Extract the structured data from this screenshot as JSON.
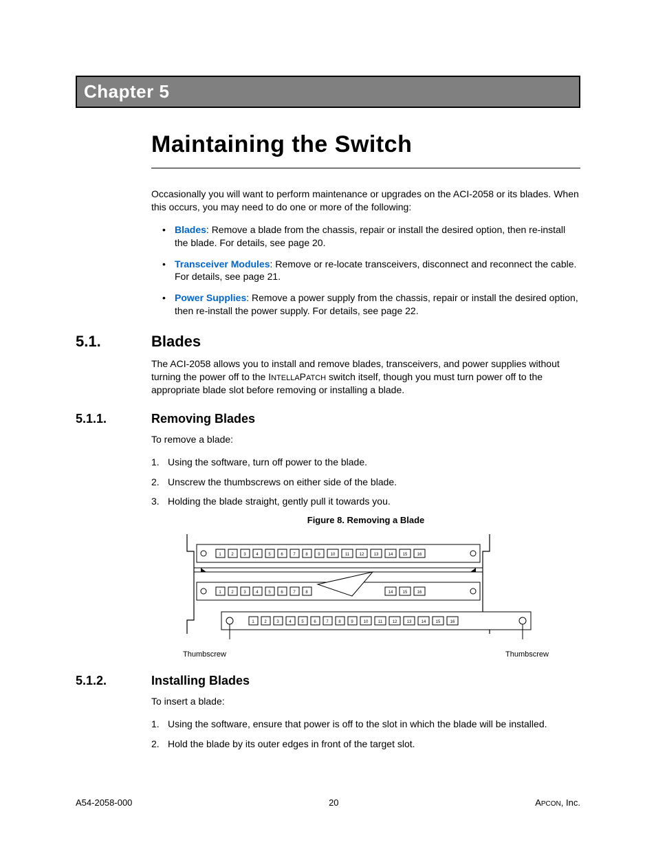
{
  "chapter_label": "Chapter 5",
  "main_title": "Maintaining the Switch",
  "intro_para": "Occasionally you will want to perform maintenance or upgrades on the ACI-2058 or its blades. When this occurs, you may need to do one or more of the following:",
  "bullets": [
    {
      "term": "Blades",
      "rest": ": Remove a blade from the chassis, repair or install the desired option, then re-install the blade. For details, see page 20."
    },
    {
      "term": "Transceiver Modules",
      "rest": ": Remove or re-locate transceivers, disconnect and reconnect the cable. For details, see page 21."
    },
    {
      "term": "Power Supplies",
      "rest": ": Remove a power supply from the chassis, repair or install the desired option, then re-install the power supply. For details, see page 22."
    }
  ],
  "sec_5_1": {
    "num": "5.1.",
    "title": "Blades"
  },
  "sec_5_1_para_a": "The ACI-2058 allows you to install and remove blades, transceivers, and power supplies without turning the power off to the I",
  "sec_5_1_para_b": "NTELLA",
  "sec_5_1_para_c": "P",
  "sec_5_1_para_d": "ATCH",
  "sec_5_1_para_e": " switch itself, though you must turn power off to the appropriate blade slot before removing or installing a blade.",
  "sec_5_1_1": {
    "num": "5.1.1.",
    "title": "Removing Blades"
  },
  "remove_intro": "To remove a blade:",
  "remove_steps": [
    "Using the software, turn off power to the blade.",
    "Unscrew the thumbscrews on either side of the blade.",
    "Holding the blade straight, gently pull it towards you."
  ],
  "figure_caption": "Figure 8. Removing a Blade",
  "thumbscrew_label": "Thumbscrew",
  "sec_5_1_2": {
    "num": "5.1.2.",
    "title": "Installing Blades"
  },
  "install_intro": "To insert a blade:",
  "install_steps": [
    "Using the software, ensure that power is off to the slot in which the blade will be installed.",
    "Hold the blade by its outer edges in front of the target slot."
  ],
  "footer": {
    "left": "A54-2058-000",
    "center": "20",
    "right_a": "A",
    "right_b": "PCON",
    "right_c": ", Inc."
  }
}
